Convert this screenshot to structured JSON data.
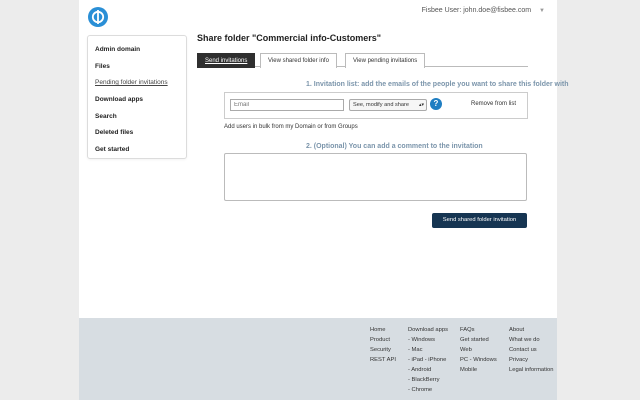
{
  "header": {
    "user_label": "Fisbee User: john.doe@fisbee.com",
    "brand_color": "#2a8fd6"
  },
  "sidebar": {
    "items": [
      {
        "label": "Admin domain"
      },
      {
        "label": "Files"
      },
      {
        "label": "Pending folder invitations"
      },
      {
        "label": "Download apps"
      },
      {
        "label": "Search"
      },
      {
        "label": "Deleted files"
      },
      {
        "label": "Get started"
      }
    ],
    "active_index": 2
  },
  "main": {
    "title": "Share folder \"Commercial info-Customers\"",
    "tabs": [
      {
        "label": "Send invitations",
        "active": true
      },
      {
        "label": "View shared folder info",
        "active": false
      },
      {
        "label": "View pending invitations",
        "active": false
      }
    ],
    "invitation_title": "1. Invitation list: add the emails of the people you want to share this folder with",
    "email_placeholder": "Email",
    "permission_selected": "See, modify and share",
    "help_icon": "?",
    "remove_label": "Remove from list",
    "bulk_text": "Add users in bulk from my Domain or from Groups",
    "comment_title": "2. (Optional) You can add a comment to the invitation",
    "send_label": "Send shared folder invitation",
    "accent_color": "#163552",
    "section_color": "#7b95ab"
  },
  "footer": {
    "col1": [
      "Home",
      "Product",
      "Security",
      "REST API"
    ],
    "col2": [
      "Download apps",
      "- Windows",
      "- Mac",
      "- iPad - iPhone",
      "- Android",
      "- BlackBerry",
      "- Chrome"
    ],
    "col3": [
      "FAQs",
      "Get started",
      "Web",
      "PC - Windows",
      "Mobile"
    ],
    "col4": [
      "About",
      "What we do",
      "Contact us",
      "Privacy",
      "Legal information"
    ]
  }
}
